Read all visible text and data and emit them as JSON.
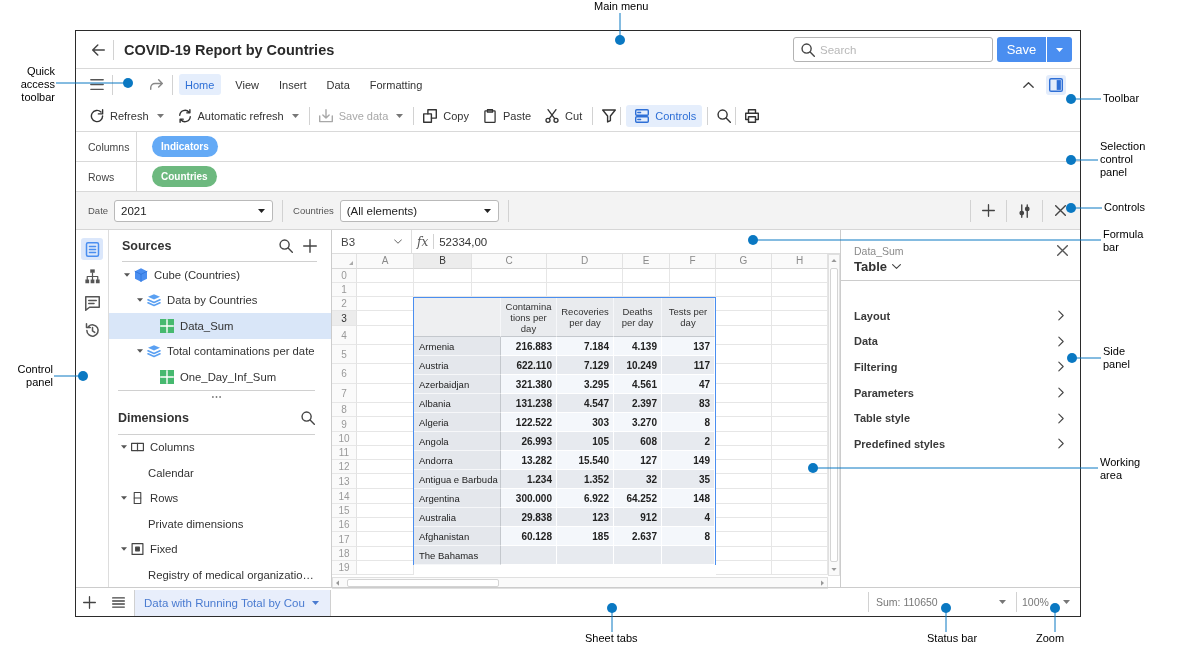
{
  "header": {
    "title": "COVID-19 Report by Countries",
    "search": {
      "placeholder": "Search"
    },
    "save": "Save"
  },
  "menu": {
    "tabs": [
      {
        "label": "Home",
        "selected": true
      },
      {
        "label": "View",
        "selected": false
      },
      {
        "label": "Insert",
        "selected": false
      },
      {
        "label": "Data",
        "selected": false
      },
      {
        "label": "Formatting",
        "selected": false
      }
    ],
    "side_panel_toggle": {
      "selected": true
    }
  },
  "toolbar": {
    "groups": [
      [
        {
          "label": "Refresh",
          "dropdown": true,
          "disabled": false,
          "selected": false
        },
        {
          "label": "Automatic refresh",
          "dropdown": true,
          "disabled": false,
          "selected": false
        }
      ],
      [
        {
          "label": "Save data",
          "dropdown": true,
          "disabled": true,
          "selected": false
        }
      ],
      [
        {
          "label": "Copy",
          "dropdown": false,
          "disabled": false,
          "selected": false
        },
        {
          "label": "Paste",
          "dropdown": false,
          "disabled": false,
          "selected": false
        },
        {
          "label": "Cut",
          "dropdown": false,
          "disabled": false,
          "selected": false
        }
      ],
      [
        {
          "dropdown": false,
          "disabled": false,
          "selected": false
        }
      ],
      [
        {
          "label": "Controls",
          "dropdown": false,
          "disabled": false,
          "selected": true
        }
      ],
      [
        {
          "dropdown": false,
          "disabled": false,
          "selected": false
        }
      ],
      [
        {
          "dropdown": false,
          "disabled": false,
          "selected": false
        }
      ]
    ]
  },
  "selection_panel": [
    {
      "label": "Columns",
      "chips": [
        {
          "label": "Indicators",
          "color": "#64aaf6"
        }
      ]
    },
    {
      "label": "Rows",
      "chips": [
        {
          "label": "Countries",
          "color": "#6db97f"
        }
      ]
    }
  ],
  "controls": [
    {
      "label": "Date",
      "value": "2021"
    },
    {
      "label": "Countries",
      "value": "(All elements)"
    }
  ],
  "rail": [
    {
      "selected": true
    },
    {
      "selected": false
    },
    {
      "selected": false
    },
    {
      "selected": false
    }
  ],
  "sources": {
    "title": "Sources",
    "tree": [
      {
        "label": "Cube (Countries)",
        "kind": "cube",
        "expanded": true,
        "selected": false,
        "children": [
          {
            "label": "Data by Countries",
            "kind": "source",
            "expanded": true,
            "selected": false,
            "children": [
              {
                "label": "Data_Sum",
                "kind": "table",
                "selected": true
              }
            ]
          },
          {
            "label": "Total contaminations per date",
            "kind": "source",
            "expanded": true,
            "selected": false,
            "children": [
              {
                "label": "One_Day_Inf_Sum",
                "kind": "table",
                "selected": false
              }
            ]
          }
        ]
      }
    ]
  },
  "dimensions": {
    "title": "Dimensions",
    "tree": [
      {
        "label": "Columns",
        "kind": "columns",
        "expanded": true,
        "selected": false,
        "children": [
          {
            "label": "Calendar",
            "selected": false
          }
        ]
      },
      {
        "label": "Rows",
        "kind": "rows",
        "expanded": true,
        "selected": false,
        "children": [
          {
            "label": "Private dimensions",
            "selected": false
          }
        ]
      },
      {
        "label": "Fixed",
        "kind": "fixed",
        "expanded": true,
        "selected": false,
        "children": [
          {
            "label": "Registry of medical organizatio…",
            "selected": false
          }
        ]
      }
    ]
  },
  "formula_bar": {
    "cell": "B3",
    "function_label": "fx",
    "value": "52334,00"
  },
  "sheet": {
    "columns": [
      {
        "label": "A",
        "selected": false
      },
      {
        "label": "B",
        "selected": true
      },
      {
        "label": "C",
        "selected": false
      },
      {
        "label": "D",
        "selected": false
      },
      {
        "label": "E",
        "selected": false
      },
      {
        "label": "F",
        "selected": false
      },
      {
        "label": "G",
        "selected": false
      },
      {
        "label": "H",
        "selected": false
      }
    ],
    "rows": [
      {
        "label": "0",
        "selected": false
      },
      {
        "label": "1",
        "selected": false
      },
      {
        "label": "2",
        "selected": false
      },
      {
        "label": "3",
        "selected": true
      },
      {
        "label": "4",
        "selected": false
      },
      {
        "label": "5",
        "selected": false
      },
      {
        "label": "6",
        "selected": false
      },
      {
        "label": "7",
        "selected": false
      },
      {
        "label": "8",
        "selected": false
      },
      {
        "label": "9",
        "selected": false
      },
      {
        "label": "10",
        "selected": false
      },
      {
        "label": "11",
        "selected": false
      },
      {
        "label": "12",
        "selected": false
      },
      {
        "label": "13",
        "selected": false
      },
      {
        "label": "14",
        "selected": false
      },
      {
        "label": "15",
        "selected": false
      },
      {
        "label": "16",
        "selected": false
      },
      {
        "label": "17",
        "selected": false
      },
      {
        "label": "18",
        "selected": false
      },
      {
        "label": "19",
        "selected": false
      }
    ],
    "pivot": {
      "columns": [
        "Contaminations per day",
        "Recoveries per day",
        "Deaths per day",
        "Tests per day"
      ],
      "rows": [
        {
          "label": "Armenia",
          "values": [
            "216.883",
            "7.184",
            "4.139",
            "137"
          ]
        },
        {
          "label": "Austria",
          "values": [
            "622.110",
            "7.129",
            "10.249",
            "117"
          ]
        },
        {
          "label": "Azerbaidjan",
          "values": [
            "321.380",
            "3.295",
            "4.561",
            "47"
          ]
        },
        {
          "label": "Albania",
          "values": [
            "131.238",
            "4.547",
            "2.397",
            "83"
          ]
        },
        {
          "label": "Algeria",
          "values": [
            "122.522",
            "303",
            "3.270",
            "8"
          ]
        },
        {
          "label": "Angola",
          "values": [
            "26.993",
            "105",
            "608",
            "2"
          ]
        },
        {
          "label": "Andorra",
          "values": [
            "13.282",
            "15.540",
            "127",
            "149"
          ]
        },
        {
          "label": "Antigua e Barbuda",
          "values": [
            "1.234",
            "1.352",
            "32",
            "35"
          ]
        },
        {
          "label": "Argentina",
          "values": [
            "300.000",
            "6.922",
            "64.252",
            "148"
          ]
        },
        {
          "label": "Australia",
          "values": [
            "29.838",
            "123",
            "912",
            "4"
          ]
        },
        {
          "label": "Afghanistan",
          "values": [
            "60.128",
            "185",
            "2.637",
            "8"
          ]
        },
        {
          "label": "The Bahamas"
        }
      ]
    }
  },
  "side_panel": {
    "subtitle": "Data_Sum",
    "title": "Table",
    "items": [
      "Layout",
      "Data",
      "Filtering",
      "Parameters",
      "Table style",
      "Predefined styles"
    ]
  },
  "sheet_tabs": [
    {
      "label": "Data with Running Total by Cou",
      "selected": true
    }
  ],
  "status_bar": {
    "sum": "Sum: 110650",
    "zoom": "100%"
  },
  "callouts": [
    {
      "label": "Main menu"
    },
    {
      "label": "Quick access toolbar"
    },
    {
      "label": "Toolbar"
    },
    {
      "label": "Selection control panel"
    },
    {
      "label": "Controls"
    },
    {
      "label": "Formula bar"
    },
    {
      "label": "Control panel"
    },
    {
      "label": "Side panel"
    },
    {
      "label": "Working area"
    },
    {
      "label": "Sheet tabs"
    },
    {
      "label": "Status bar"
    },
    {
      "label": "Zoom"
    }
  ]
}
